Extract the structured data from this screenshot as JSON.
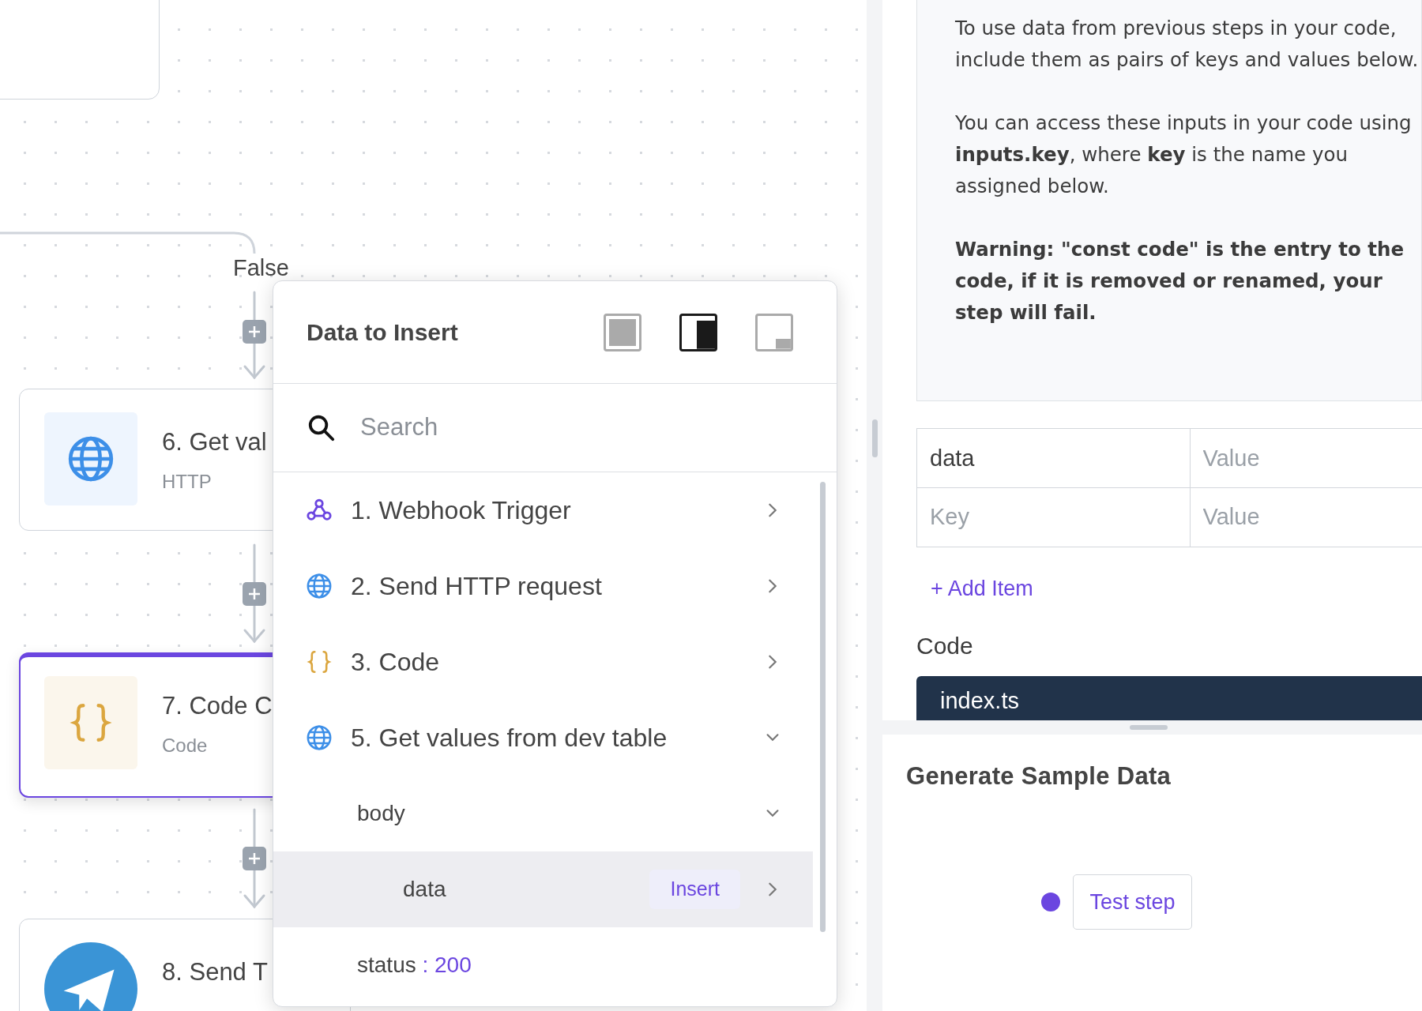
{
  "canvas": {
    "branch_label": "False",
    "nodes": [
      {
        "title": "6. Get val",
        "subtitle": "HTTP",
        "kind": "http",
        "selected": false
      },
      {
        "title": "7. Code C",
        "subtitle": "Code",
        "kind": "code",
        "selected": true
      },
      {
        "title": "8. Send T",
        "kind": "telegram",
        "selected": false
      }
    ]
  },
  "data_picker": {
    "title": "Data to Insert",
    "layouts": [
      {
        "kind": "full",
        "selected": false
      },
      {
        "kind": "side",
        "selected": true
      },
      {
        "kind": "corner",
        "selected": false
      }
    ],
    "search": {
      "placeholder": "Search"
    },
    "steps": [
      {
        "label": "1. Webhook Trigger",
        "kind": "webhook",
        "expanded": false
      },
      {
        "label": "2. Send HTTP request",
        "kind": "http",
        "expanded": false
      },
      {
        "label": "3. Code",
        "kind": "code",
        "expanded": false
      },
      {
        "label": "5. Get values from dev table",
        "kind": "http",
        "expanded": true,
        "children": [
          {
            "label": "body",
            "expanded": true,
            "children": [
              {
                "label": "data",
                "expanded": false,
                "selected": true,
                "action": "Insert"
              }
            ]
          },
          {
            "label": "status",
            "value": ": 200"
          }
        ]
      }
    ]
  },
  "inputs_panel": {
    "description": [
      "To use data from previous steps in your code, include them as pairs of keys and values below.",
      "You can access these inputs in your code using **inputs.key**, where **key** is the name you assigned below.",
      "**Warning: \"const code\" is the entry to the code, if it is removed or renamed, your step will fail.**"
    ],
    "fields": [
      {
        "key": "data",
        "value_placeholder": "Value"
      },
      {
        "key_placeholder": "Key",
        "value_placeholder": "Value"
      }
    ],
    "add_item": "+ Add Item",
    "code_label": "Code",
    "code_tab": "index.ts"
  },
  "sample_panel": {
    "title": "Generate Sample Data",
    "button": "Test step"
  }
}
